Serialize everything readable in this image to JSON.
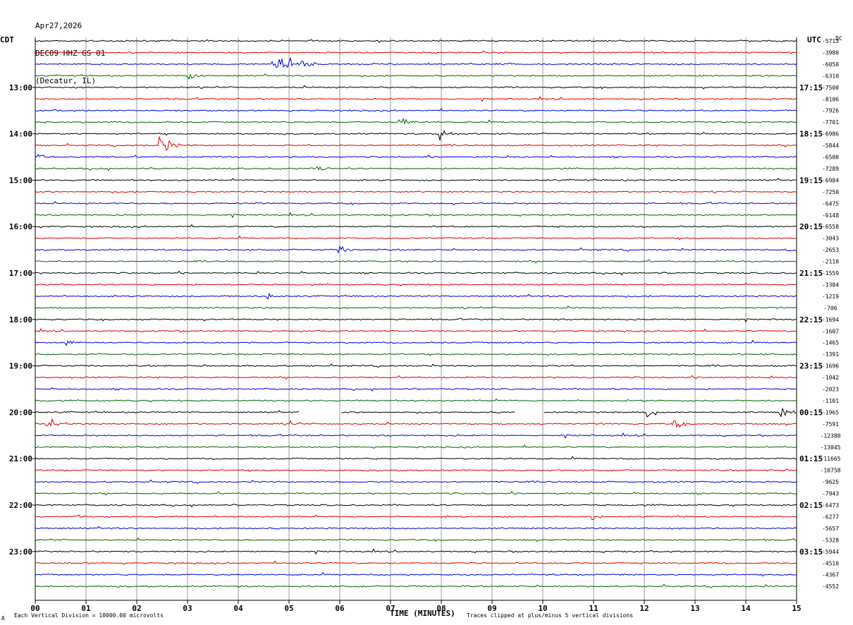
{
  "header": {
    "date": "Apr27,2026",
    "station": "DEC09 HHZ GS 01",
    "location": "(Decatur, IL)"
  },
  "left_tz": "CDT",
  "right_tz": "UTC",
  "dc_label": "DC",
  "footer": {
    "scale_note": "Each Vertical Division = 10000.00 microvolts",
    "clip_note": "Traces clipped at plus/minus 5 vertical divisions",
    "mark": "A"
  },
  "colors": [
    "#000000",
    "#e00000",
    "#0000e0",
    "#006400"
  ],
  "chart_data": {
    "type": "line",
    "title": "DEC09 HHZ GS 01",
    "xlabel": "TIME (MINUTES)",
    "xlim": [
      0,
      15
    ],
    "x_ticks": [
      "00",
      "01",
      "02",
      "03",
      "04",
      "05",
      "06",
      "07",
      "08",
      "09",
      "10",
      "11",
      "12",
      "13",
      "14",
      "15"
    ],
    "rows_per_hour": 4,
    "row_minutes": 15,
    "left_hour_labels": [
      "13:00",
      "14:00",
      "15:00",
      "16:00",
      "17:00",
      "18:00",
      "19:00",
      "20:00",
      "21:00",
      "22:00",
      "23:00"
    ],
    "right_hour_labels": [
      "17:15",
      "18:15",
      "19:15",
      "20:15",
      "21:15",
      "22:15",
      "23:15",
      "00:15",
      "01:15",
      "02:15",
      "03:15"
    ],
    "dc_offsets": [
      "-5713",
      "-3980",
      "-6050",
      "-6310",
      "-7500",
      "-8106",
      "-7926",
      "-7701",
      "-6986",
      "-5844",
      "-6500",
      "-7289",
      "-6984",
      "-7250",
      "-6475",
      "-6148",
      "-6558",
      "-3043",
      "-2653",
      "-2110",
      "-1559",
      "-1384",
      "-1219",
      "-706",
      "-1694",
      "-1607",
      "-1465",
      "-1391",
      "-1696",
      "-1042",
      "-2023",
      "-1101",
      "-1965",
      "-7591",
      "-12380",
      "-13045",
      "-11665",
      "-10758",
      "-9625",
      "-7943",
      "-6473",
      "-6277",
      "-5657",
      "-5328",
      "-5944",
      "-4510",
      "-4367",
      "-4552"
    ],
    "events": [
      {
        "row": 2,
        "minute": 4.7,
        "amp": 1.0,
        "dur": 0.9
      },
      {
        "row": 3,
        "minute": 3.05,
        "amp": 0.6,
        "dur": 0.3
      },
      {
        "row": 9,
        "minute": 2.45,
        "amp": 1.0,
        "dur": 0.4
      },
      {
        "row": 8,
        "minute": 8.0,
        "amp": 0.5,
        "dur": 0.4
      },
      {
        "row": 7,
        "minute": 7.2,
        "amp": 0.45,
        "dur": 0.3
      },
      {
        "row": 10,
        "minute": 0.1,
        "amp": 0.35,
        "dur": 0.3
      },
      {
        "row": 11,
        "minute": 5.6,
        "amp": 0.3,
        "dur": 0.4
      },
      {
        "row": 18,
        "minute": 6.0,
        "amp": 0.3,
        "dur": 0.4
      },
      {
        "row": 18,
        "minute": 14.8,
        "amp": 0.3,
        "dur": 0.3
      },
      {
        "row": 22,
        "minute": 4.6,
        "amp": 0.35,
        "dur": 0.3
      },
      {
        "row": 26,
        "minute": 0.65,
        "amp": 0.3,
        "dur": 0.2
      },
      {
        "row": 32,
        "minute": 12.1,
        "amp": 0.9,
        "dur": 0.2
      },
      {
        "row": 32,
        "minute": 14.7,
        "amp": 0.4,
        "dur": 0.3
      },
      {
        "row": 33,
        "minute": 0.25,
        "amp": 0.6,
        "dur": 0.4
      },
      {
        "row": 33,
        "minute": 12.6,
        "amp": 0.4,
        "dur": 0.3
      },
      {
        "row": 33,
        "minute": 5.05,
        "amp": 0.35,
        "dur": 0.2
      },
      {
        "row": 41,
        "minute": 11.0,
        "amp": 0.3,
        "dur": 0.2
      },
      {
        "row": 41,
        "minute": 0.8,
        "amp": 0.3,
        "dur": 0.2
      }
    ],
    "gaps": [
      {
        "row": 32,
        "from": 5.2,
        "to": 6.0
      },
      {
        "row": 32,
        "from": 9.45,
        "to": 10.0
      }
    ]
  }
}
